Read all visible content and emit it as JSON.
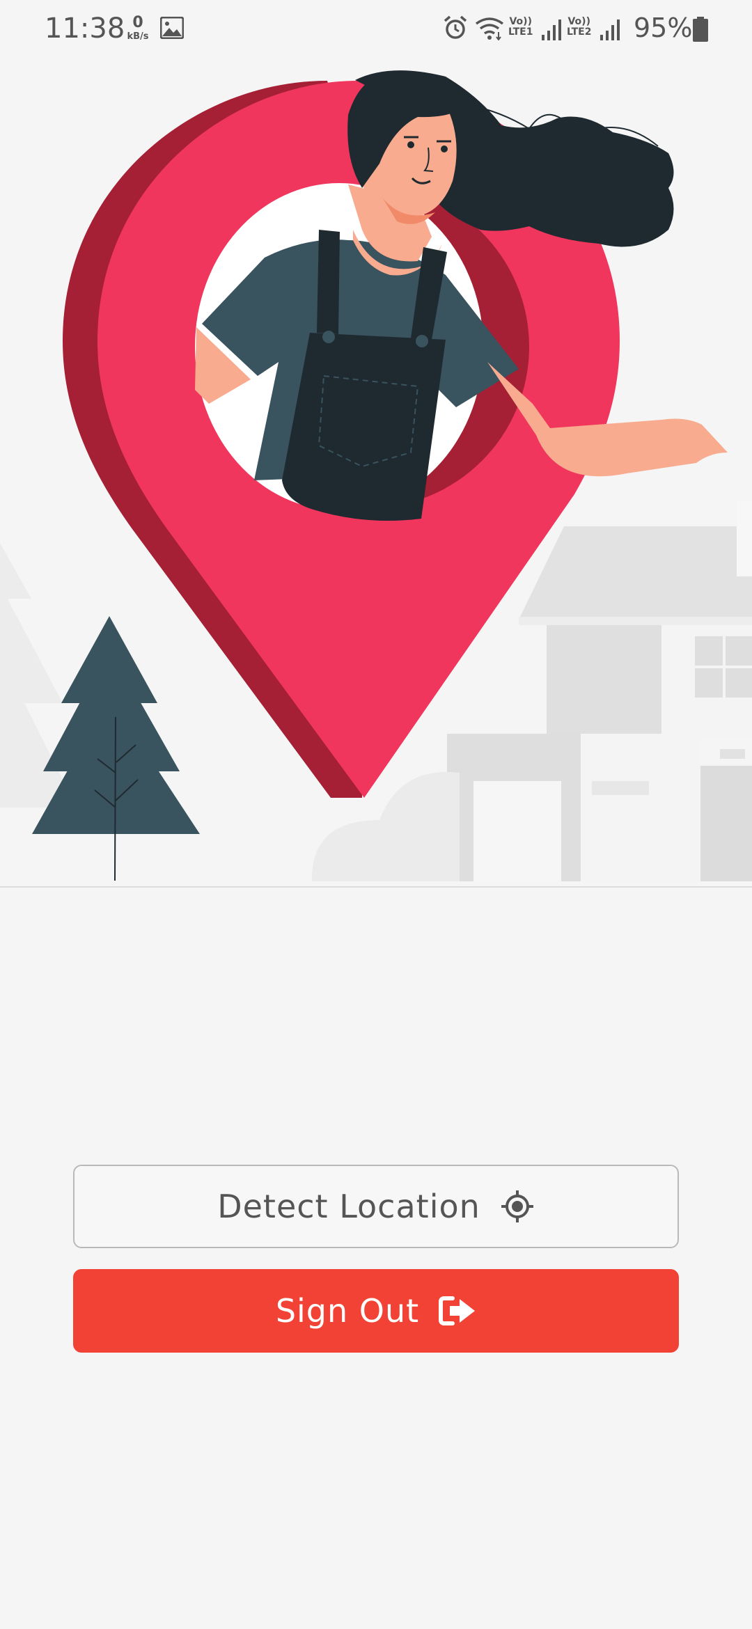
{
  "status_bar": {
    "time": "11:38",
    "net_speed_value": "0",
    "net_speed_unit": "kB/s",
    "sim1_volte": "Vo))",
    "sim1_lte": "LTE1",
    "sim2_volte": "Vo))",
    "sim2_lte": "LTE2",
    "battery": "95%",
    "icons": [
      "gallery-icon",
      "alarm-icon",
      "wifi-icon",
      "signal-icon",
      "battery-icon"
    ]
  },
  "buttons": {
    "detect_location": "Detect Location",
    "sign_out": "Sign Out"
  },
  "colors": {
    "pin_red": "#f0365c",
    "pin_dark": "#a52035",
    "primary_button": "#f24235",
    "background": "#f5f5f5"
  }
}
